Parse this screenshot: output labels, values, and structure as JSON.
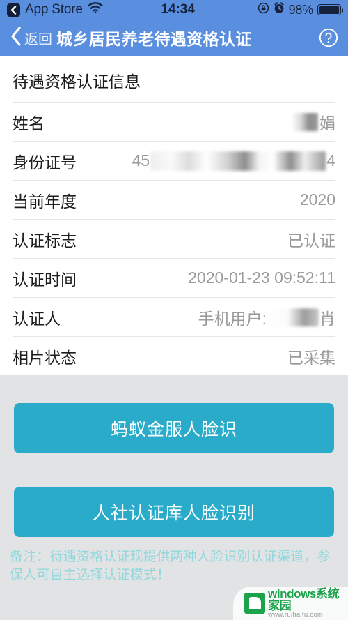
{
  "status_bar": {
    "back_app_label": "App Store",
    "back_icon": "chevron-left-icon",
    "wifi_icon": "wifi-icon",
    "time": "14:34",
    "rotation_lock_icon": "rotation-lock-icon",
    "alarm_icon": "alarm-clock-icon",
    "battery_percent": "98%",
    "battery_icon": "battery-icon",
    "bg_color": "#5a8ede"
  },
  "nav_bar": {
    "back_icon": "chevron-left-icon",
    "back_label": "返回",
    "title": "城乡居民养老待遇资格认证",
    "help_icon": "help-circle-icon",
    "bg_color": "#5a8ede"
  },
  "card": {
    "title": "待遇资格认证信息",
    "rows": [
      {
        "label": "姓名",
        "value_prefix": "",
        "value_suffix": "娟",
        "redacted": "name"
      },
      {
        "label": "身份证号",
        "value_prefix": "45",
        "value_suffix": "4",
        "redacted": "id"
      },
      {
        "label": "当前年度",
        "value_prefix": "2020",
        "value_suffix": "",
        "redacted": ""
      },
      {
        "label": "认证标志",
        "value_prefix": "已认证",
        "value_suffix": "",
        "redacted": ""
      },
      {
        "label": "认证时间",
        "value_prefix": "2020-01-23 09:52:11",
        "value_suffix": "",
        "redacted": ""
      },
      {
        "label": "认证人",
        "value_prefix": "手机用户:",
        "value_suffix": "肖",
        "redacted": "person"
      },
      {
        "label": "相片状态",
        "value_prefix": "已采集",
        "value_suffix": "",
        "redacted": ""
      }
    ]
  },
  "actions": {
    "primary_label": "蚂蚁金服人脸识",
    "secondary_label": "人社认证库人脸识别",
    "button_color": "#29abc9"
  },
  "note": {
    "text": "备注：待遇资格认证现提供两种人脸识别认证渠道，参保人可自主选择认证模式！",
    "color": "#8fd8dd"
  },
  "watermark": {
    "brand_prefix": "windows",
    "brand_suffix": "系统家园",
    "url": "www.ruihaifu.com",
    "logo_icon": "windows-house-logo-icon"
  }
}
